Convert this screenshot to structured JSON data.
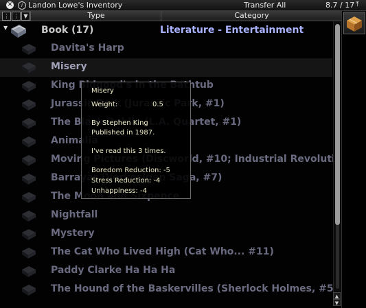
{
  "window": {
    "title": "Landon Lowe's Inventory",
    "transfer_label": "Transfer All",
    "weight_readout": "8.7 / 17"
  },
  "columns": {
    "type": "Type",
    "category": "Category"
  },
  "group": {
    "name": "Book (17)",
    "category": "Literature - Entertainment",
    "icon": "book-icon"
  },
  "items": [
    {
      "name": "Davita's Harp",
      "selected": false
    },
    {
      "name": "Misery",
      "selected": true
    },
    {
      "name": "King Bidgood's in the Bathtub",
      "selected": false
    },
    {
      "name": "Jurassic Park (Jurassic Park, #1)",
      "selected": false
    },
    {
      "name": "The Black Dahlia (L.A. Quartet, #1)",
      "selected": false
    },
    {
      "name": "Animalia",
      "selected": false
    },
    {
      "name": "Moving Pictures (Discworld, #10; Industrial Revolution, #1)",
      "selected": false
    },
    {
      "name": "Barrayar (Vorkosigan Saga, #7)",
      "selected": false
    },
    {
      "name": "The Moon and Sixpence",
      "selected": false
    },
    {
      "name": "Nightfall",
      "selected": false
    },
    {
      "name": "Mystery",
      "selected": false
    },
    {
      "name": "The Cat Who Lived High (Cat Who... #11)",
      "selected": false
    },
    {
      "name": "Paddy Clarke Ha Ha Ha",
      "selected": false
    },
    {
      "name": "The Hound of the Baskervilles (Sherlock Holmes, #5)",
      "selected": false
    }
  ],
  "tooltip": {
    "title": "Misery",
    "weight_label": "Weight:",
    "weight_value": "0.5",
    "author": "By Stephen King",
    "published": "Published in 1987.",
    "read_count": "I've read this 3 times.",
    "boredom": "Boredom Reduction: -5",
    "stress": "Stress Reduction: -4",
    "unhappiness": "Unhappiness: -4"
  },
  "scroll": {
    "position_fraction": 0.0,
    "visible_fraction": 0.76
  },
  "colors": {
    "item_text": "#6a6b80",
    "category_text": "#a9b2ff",
    "tooltip_text": "#f0eec8"
  }
}
